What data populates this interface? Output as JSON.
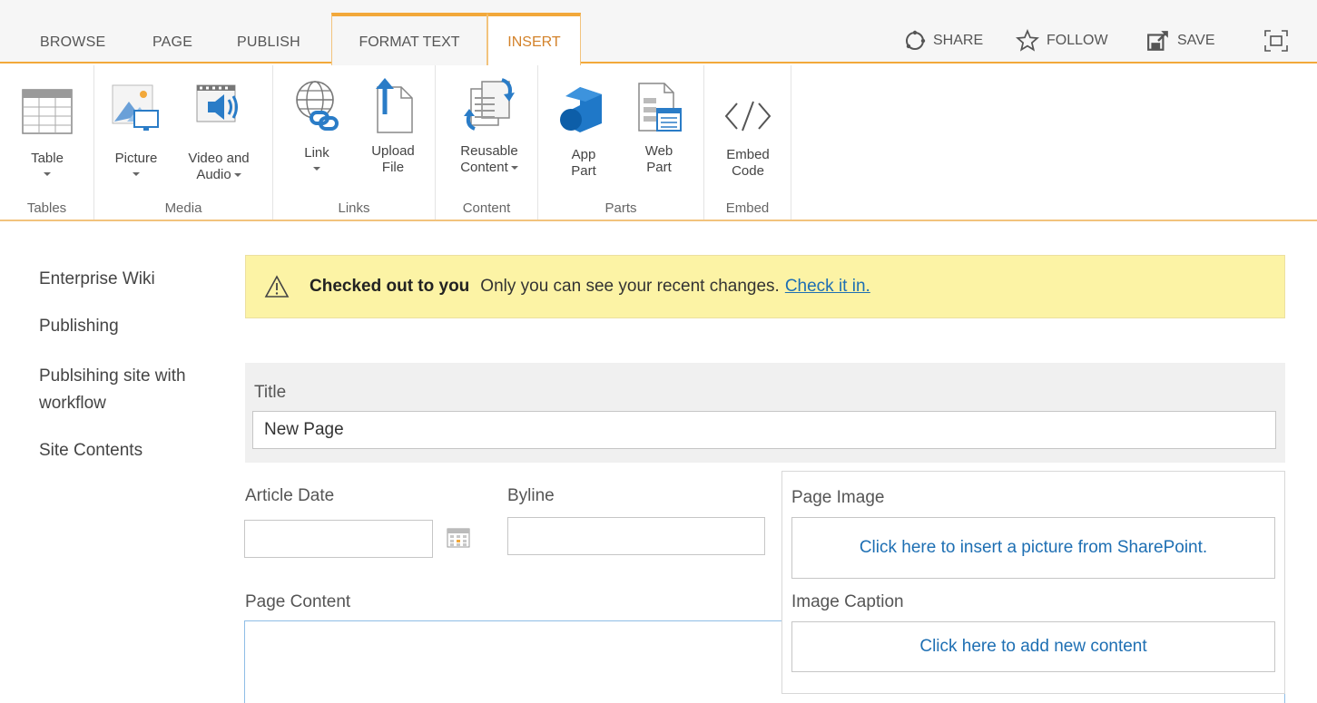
{
  "tabs": {
    "browse": "BROWSE",
    "page": "PAGE",
    "publish": "PUBLISH",
    "format_text": "FORMAT TEXT",
    "insert": "INSERT"
  },
  "actions": {
    "share": "SHARE",
    "follow": "FOLLOW",
    "save": "SAVE"
  },
  "ribbon": {
    "groups": {
      "tables": "Tables",
      "media": "Media",
      "links": "Links",
      "content": "Content",
      "parts": "Parts",
      "embed": "Embed"
    },
    "buttons": {
      "table": "Table",
      "picture": "Picture",
      "video_audio": "Video and\nAudio",
      "link": "Link",
      "upload_file": "Upload\nFile",
      "reusable_content": "Reusable\nContent",
      "app_part": "App\nPart",
      "web_part": "Web\nPart",
      "embed_code": "Embed\nCode"
    }
  },
  "nav": {
    "items": [
      "Enterprise Wiki",
      "Publishing",
      "Publsihing site with\nworkflow",
      "Site Contents"
    ]
  },
  "banner": {
    "strong": "Checked out to you",
    "message": "Only you can see your recent changes.",
    "link": "Check it in."
  },
  "form": {
    "title_label": "Title",
    "title_value": "New Page",
    "article_date_label": "Article Date",
    "byline_label": "Byline",
    "page_content_label": "Page Content",
    "page_image_label": "Page Image",
    "page_image_placeholder": "Click here to insert a picture from SharePoint.",
    "image_caption_label": "Image Caption",
    "image_caption_placeholder": "Click here to add new content"
  },
  "colors": {
    "accent": "#f2a83a",
    "selected_tab": "#d3822a",
    "banner_bg": "#fcf3a5",
    "link": "#1e6fb3"
  }
}
